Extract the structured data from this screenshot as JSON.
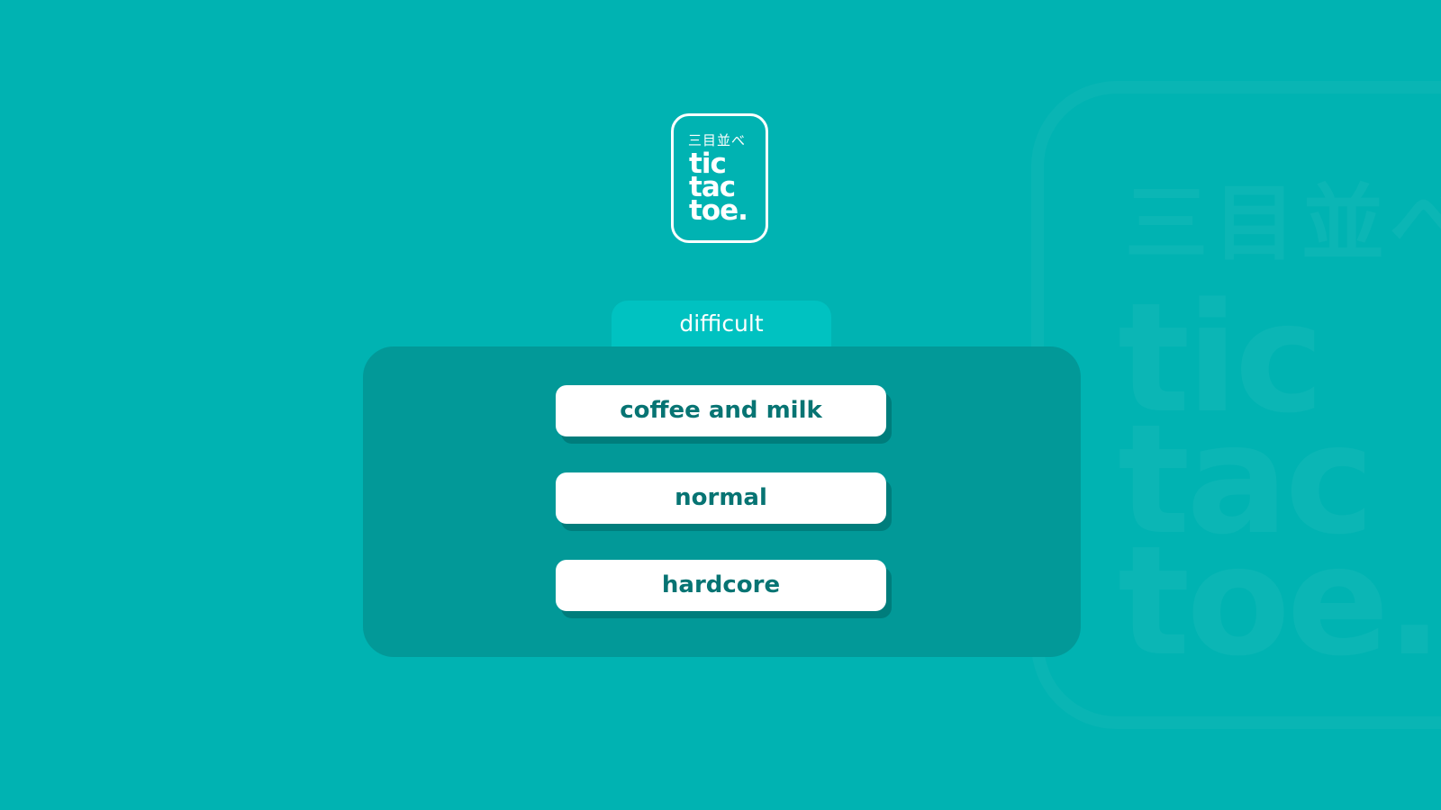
{
  "background_color": "#00b3b2",
  "logo": {
    "kana": "三目並べ",
    "lines": [
      "tic",
      "tac",
      "toe."
    ]
  },
  "watermark": {
    "kana": "三目並べ",
    "lines": [
      "tic",
      "tac",
      "toe."
    ]
  },
  "difficulty_tab": {
    "label": "difficult",
    "color": "#00c2c1"
  },
  "panel": {
    "color": "#029998"
  },
  "options": [
    {
      "label": "coffee and milk"
    },
    {
      "label": "normal"
    },
    {
      "label": "hardcore"
    }
  ],
  "option_text_color": "#077473"
}
